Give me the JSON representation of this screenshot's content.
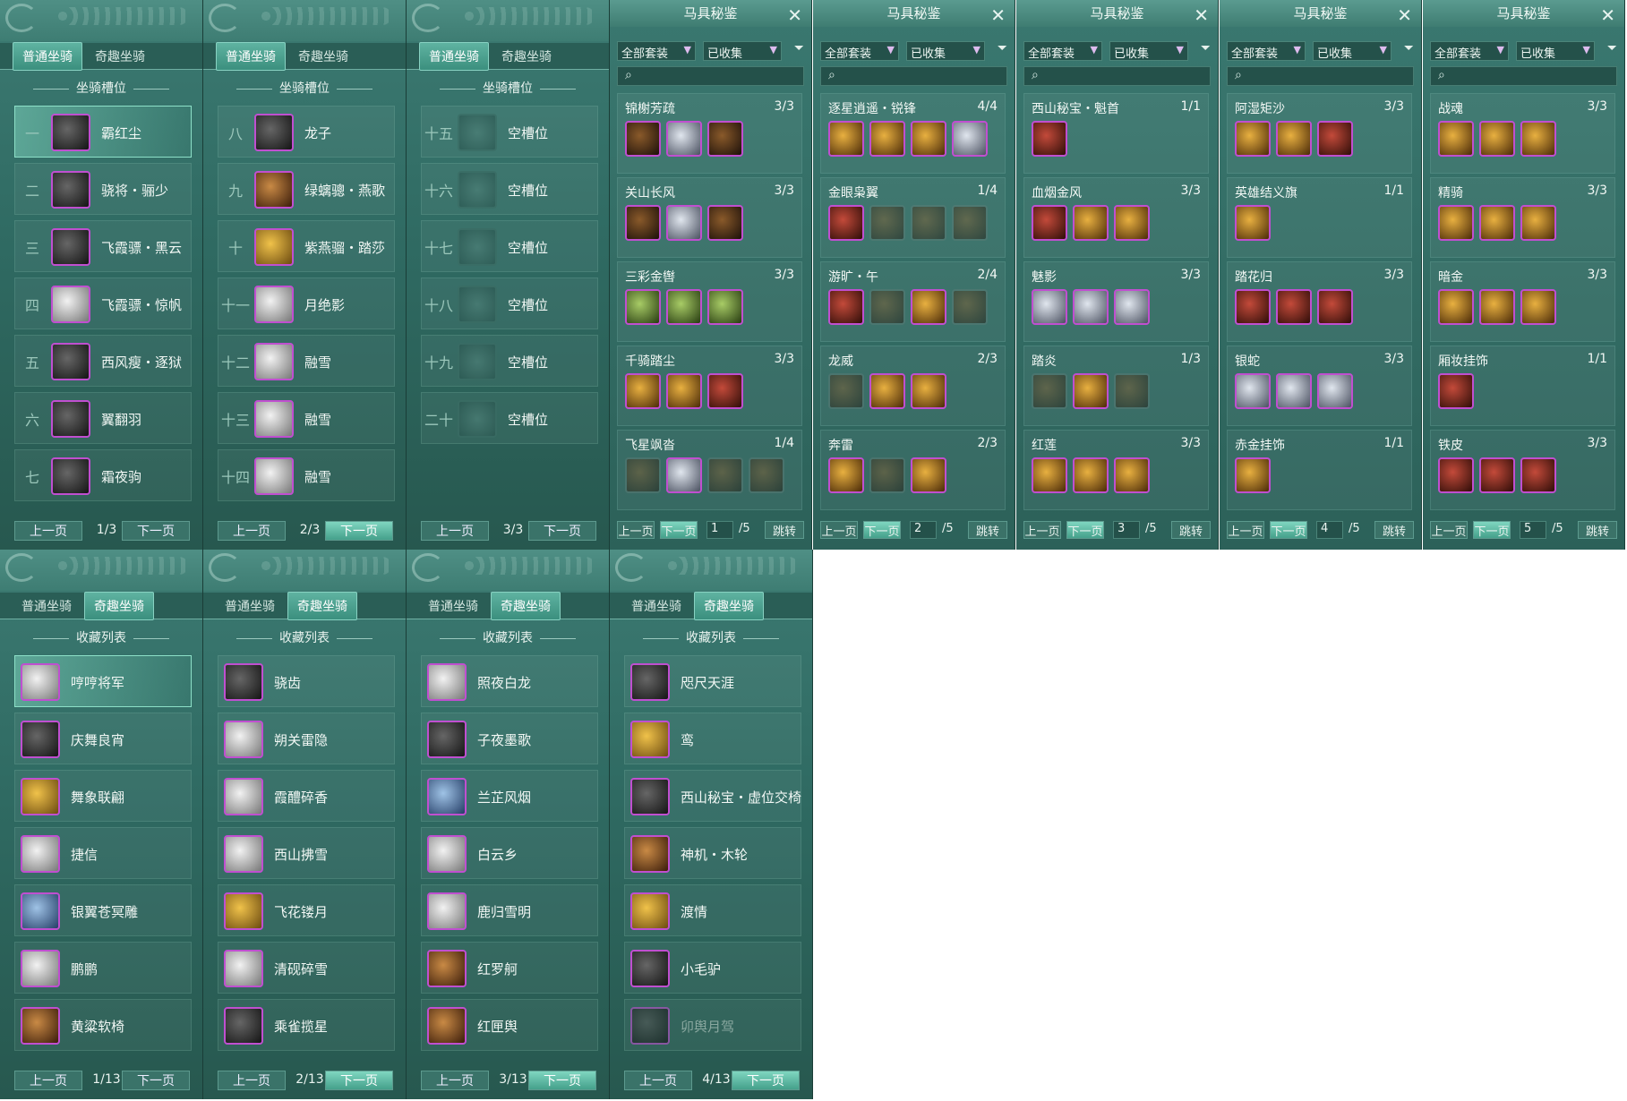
{
  "tabs": {
    "normal": "普通坐骑",
    "special": "奇趣坐骑"
  },
  "slot_header": "坐骑槽位",
  "collection_header": "收藏列表",
  "prev_label": "上一页",
  "next_label": "下一页",
  "empty_slot": "空槽位",
  "mount_pages": [
    {
      "page": "1/3",
      "rows": [
        {
          "num": "一",
          "name": "霸红尘",
          "icon": "black-horse",
          "selected": true
        },
        {
          "num": "二",
          "name": "骁将・骊少",
          "icon": "black-horse"
        },
        {
          "num": "三",
          "name": "飞霞骠・黑云",
          "icon": "black-horse"
        },
        {
          "num": "四",
          "name": "飞霞骠・惊帆",
          "icon": "white-horse"
        },
        {
          "num": "五",
          "name": "西风瘦・逐狱",
          "icon": "black-horse"
        },
        {
          "num": "六",
          "name": "翼翻羽",
          "icon": "black-horse"
        },
        {
          "num": "七",
          "name": "霜夜驹",
          "icon": "black-horse"
        }
      ]
    },
    {
      "page": "2/3",
      "rows": [
        {
          "num": "八",
          "name": "龙子",
          "icon": "black-horse"
        },
        {
          "num": "九",
          "name": "绿螭骢・燕歌",
          "icon": "brown-horse"
        },
        {
          "num": "十",
          "name": "紫燕骝・踏莎",
          "icon": "gold-horse"
        },
        {
          "num": "十一",
          "name": "月绝影",
          "icon": "white-horse"
        },
        {
          "num": "十二",
          "name": "融雪",
          "icon": "white-horse"
        },
        {
          "num": "十三",
          "name": "融雪",
          "icon": "white-horse"
        },
        {
          "num": "十四",
          "name": "融雪",
          "icon": "white-horse"
        }
      ]
    },
    {
      "page": "3/3",
      "rows": [
        {
          "num": "十五",
          "name": "空槽位",
          "icon": "empty"
        },
        {
          "num": "十六",
          "name": "空槽位",
          "icon": "empty"
        },
        {
          "num": "十七",
          "name": "空槽位",
          "icon": "empty"
        },
        {
          "num": "十八",
          "name": "空槽位",
          "icon": "empty"
        },
        {
          "num": "十九",
          "name": "空槽位",
          "icon": "empty"
        },
        {
          "num": "二十",
          "name": "空槽位",
          "icon": "empty"
        }
      ]
    }
  ],
  "collection_pages": [
    {
      "page": "1/13",
      "rows": [
        {
          "name": "哼哼将军",
          "icon": "pig",
          "selected": true
        },
        {
          "name": "庆舞良宵",
          "icon": "lion-dance"
        },
        {
          "name": "舞象联翩",
          "icon": "elephant"
        },
        {
          "name": "捷信",
          "icon": "white-beast"
        },
        {
          "name": "银翼苍冥雕",
          "icon": "eagle"
        },
        {
          "name": "鹏鹏",
          "icon": "white-horse"
        },
        {
          "name": "黄粱软椅",
          "icon": "chair"
        }
      ]
    },
    {
      "page": "2/13",
      "rows": [
        {
          "name": "骁齿",
          "icon": "wolf"
        },
        {
          "name": "朔关雷隐",
          "icon": "white-horse"
        },
        {
          "name": "霞醴碎香",
          "icon": "white-horse"
        },
        {
          "name": "西山拂雪",
          "icon": "white-beast"
        },
        {
          "name": "飞花镂月",
          "icon": "gold-orb"
        },
        {
          "name": "清砚碎雪",
          "icon": "white-horse"
        },
        {
          "name": "乘雀揽星",
          "icon": "lotus"
        }
      ]
    },
    {
      "page": "3/13",
      "rows": [
        {
          "name": "照夜白龙",
          "icon": "white-horse"
        },
        {
          "name": "子夜墨歌",
          "icon": "dark-beast"
        },
        {
          "name": "兰芷风烟",
          "icon": "armored-horse"
        },
        {
          "name": "白云乡",
          "icon": "white-beast"
        },
        {
          "name": "鹿归雪明",
          "icon": "deer"
        },
        {
          "name": "红罗舸",
          "icon": "red-boat"
        },
        {
          "name": "红匣舆",
          "icon": "red-box"
        }
      ]
    },
    {
      "page": "4/13",
      "rows": [
        {
          "name": "咫尺天涯",
          "icon": "puppet"
        },
        {
          "name": "鸾",
          "icon": "gold-hat"
        },
        {
          "name": "西山秘宝・虚位交椅",
          "icon": "lady"
        },
        {
          "name": "神机・木轮",
          "icon": "wooden-wheel"
        },
        {
          "name": "渡情",
          "icon": "bamboo-raft"
        },
        {
          "name": "小毛驴",
          "icon": "donkey"
        },
        {
          "name": "卯舆月驾",
          "icon": "carriage",
          "dim": true
        }
      ]
    }
  ],
  "tack": {
    "title": "马具秘鉴",
    "filter_all": "全部套装",
    "filter_collected": "已收集",
    "jump_label": "跳转",
    "total": "/5",
    "pages": [
      {
        "page": "1",
        "sets": [
          {
            "name": "锦榭芳疏",
            "count": "3/3",
            "items": [
              "dark",
              "silver",
              "dark"
            ]
          },
          {
            "name": "关山长风",
            "count": "3/3",
            "items": [
              "dark",
              "silver",
              "dark"
            ]
          },
          {
            "name": "三彩金辔",
            "count": "3/3",
            "items": [
              "green",
              "green",
              "green"
            ]
          },
          {
            "name": "千骑踏尘",
            "count": "3/3",
            "items": [
              "gold",
              "gold",
              "red"
            ]
          },
          {
            "name": "飞星飒沓",
            "count": "1/4",
            "items": [
              "dim",
              "silver",
              "dim",
              "dim"
            ]
          }
        ]
      },
      {
        "page": "2",
        "sets": [
          {
            "name": "逐星逍遥・锐锋",
            "count": "4/4",
            "items": [
              "gold",
              "gold",
              "gold",
              "silver"
            ]
          },
          {
            "name": "金眼枭翼",
            "count": "1/4",
            "items": [
              "red",
              "dim",
              "dim",
              "dim"
            ]
          },
          {
            "name": "游旷・午",
            "count": "2/4",
            "items": [
              "red",
              "dim",
              "gold",
              "dim"
            ]
          },
          {
            "name": "龙威",
            "count": "2/3",
            "items": [
              "dim",
              "gold",
              "gold"
            ]
          },
          {
            "name": "奔雷",
            "count": "2/3",
            "items": [
              "gold",
              "dim",
              "gold"
            ]
          }
        ]
      },
      {
        "page": "3",
        "sets": [
          {
            "name": "西山秘宝・魁首",
            "count": "1/1",
            "items": [
              "red"
            ]
          },
          {
            "name": "血烟金风",
            "count": "3/3",
            "items": [
              "red",
              "gold",
              "gold"
            ]
          },
          {
            "name": "魅影",
            "count": "3/3",
            "items": [
              "silver",
              "silver",
              "silver"
            ]
          },
          {
            "name": "踏炎",
            "count": "1/3",
            "items": [
              "dim",
              "gold",
              "dim"
            ]
          },
          {
            "name": "红莲",
            "count": "3/3",
            "items": [
              "gold",
              "gold",
              "gold"
            ]
          }
        ]
      },
      {
        "page": "4",
        "sets": [
          {
            "name": "阿湿矩沙",
            "count": "3/3",
            "items": [
              "gold",
              "gold",
              "red"
            ]
          },
          {
            "name": "英雄结义旗",
            "count": "1/1",
            "items": [
              "gold"
            ]
          },
          {
            "name": "踏花归",
            "count": "3/3",
            "items": [
              "red",
              "red",
              "red"
            ]
          },
          {
            "name": "银蛇",
            "count": "3/3",
            "items": [
              "silver",
              "silver",
              "silver"
            ]
          },
          {
            "name": "赤金挂饰",
            "count": "1/1",
            "items": [
              "gold"
            ]
          }
        ]
      },
      {
        "page": "5",
        "sets": [
          {
            "name": "战魂",
            "count": "3/3",
            "items": [
              "gold",
              "gold",
              "gold"
            ]
          },
          {
            "name": "精骑",
            "count": "3/3",
            "items": [
              "gold",
              "gold",
              "gold"
            ]
          },
          {
            "name": "暗金",
            "count": "3/3",
            "items": [
              "gold",
              "gold",
              "gold"
            ]
          },
          {
            "name": "厢妆挂饰",
            "count": "1/1",
            "items": [
              "red"
            ]
          },
          {
            "name": "铁皮",
            "count": "3/3",
            "items": [
              "red",
              "red",
              "red"
            ]
          }
        ]
      }
    ]
  }
}
